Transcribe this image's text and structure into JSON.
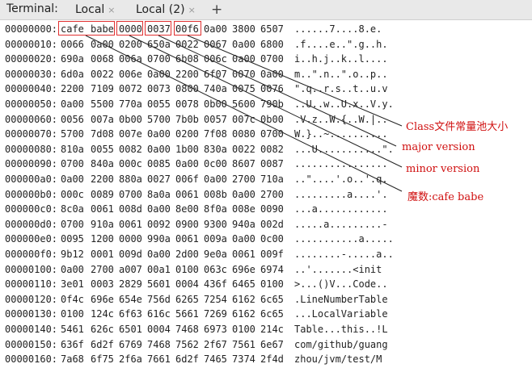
{
  "tabbar": {
    "title": "Terminal:",
    "tabs": [
      {
        "label": "Local",
        "close": "×"
      },
      {
        "label": "Local (2)",
        "close": "×"
      }
    ],
    "new_tab": "+"
  },
  "rows": [
    {
      "addr": "00000000:",
      "words": [
        "cafe",
        "babe",
        "0000",
        "0037",
        "00f6",
        "0a00",
        "3800",
        "6507"
      ],
      "ascii": "......7....8.e."
    },
    {
      "addr": "00000010:",
      "words": [
        "0066",
        "0a00",
        "0200",
        "650a",
        "0022",
        "0067",
        "0a00",
        "6800"
      ],
      "ascii": ".f....e..\".g..h."
    },
    {
      "addr": "00000020:",
      "words": [
        "690a",
        "0068",
        "006a",
        "0700",
        "6b08",
        "006c",
        "0a00",
        "0700"
      ],
      "ascii": "i..h.j..k..l...."
    },
    {
      "addr": "00000030:",
      "words": [
        "6d0a",
        "0022",
        "006e",
        "0a00",
        "2200",
        "6f07",
        "0070",
        "0a00"
      ],
      "ascii": "m..\".n..\".o..p.."
    },
    {
      "addr": "00000040:",
      "words": [
        "2200",
        "7109",
        "0072",
        "0073",
        "0800",
        "740a",
        "0075",
        "0076"
      ],
      "ascii": "\".q..r.s..t..u.v"
    },
    {
      "addr": "00000050:",
      "words": [
        "0a00",
        "5500",
        "770a",
        "0055",
        "0078",
        "0b00",
        "5600",
        "790b"
      ],
      "ascii": "..U..w..U.x..V.y."
    },
    {
      "addr": "00000060:",
      "words": [
        "0056",
        "007a",
        "0b00",
        "5700",
        "7b0b",
        "0057",
        "007c",
        "0b00"
      ],
      "ascii": ".V.z..W.{..W.|.."
    },
    {
      "addr": "00000070:",
      "words": [
        "5700",
        "7d08",
        "007e",
        "0a00",
        "0200",
        "7f08",
        "0080",
        "0700"
      ],
      "ascii": "W.}..~.........."
    },
    {
      "addr": "00000080:",
      "words": [
        "810a",
        "0055",
        "0082",
        "0a00",
        "1b00",
        "830a",
        "0022",
        "0082"
      ],
      "ascii": "...U...........\"."
    },
    {
      "addr": "00000090:",
      "words": [
        "0700",
        "840a",
        "000c",
        "0085",
        "0a00",
        "0c00",
        "8607",
        "0087"
      ],
      "ascii": "................"
    },
    {
      "addr": "000000a0:",
      "words": [
        "0a00",
        "2200",
        "880a",
        "0027",
        "006f",
        "0a00",
        "2700",
        "710a"
      ],
      "ascii": "..\"....'.o..'.q."
    },
    {
      "addr": "000000b0:",
      "words": [
        "000c",
        "0089",
        "0700",
        "8a0a",
        "0061",
        "008b",
        "0a00",
        "2700"
      ],
      "ascii": ".........a....'."
    },
    {
      "addr": "000000c0:",
      "words": [
        "8c0a",
        "0061",
        "008d",
        "0a00",
        "8e00",
        "8f0a",
        "008e",
        "0090"
      ],
      "ascii": "...a............"
    },
    {
      "addr": "000000d0:",
      "words": [
        "0700",
        "910a",
        "0061",
        "0092",
        "0900",
        "9300",
        "940a",
        "002d"
      ],
      "ascii": ".....a.........-"
    },
    {
      "addr": "000000e0:",
      "words": [
        "0095",
        "1200",
        "0000",
        "990a",
        "0061",
        "009a",
        "0a00",
        "0c00"
      ],
      "ascii": "...........a....."
    },
    {
      "addr": "000000f0:",
      "words": [
        "9b12",
        "0001",
        "009d",
        "0a00",
        "2d00",
        "9e0a",
        "0061",
        "009f"
      ],
      "ascii": "........-.....a.."
    },
    {
      "addr": "00000100:",
      "words": [
        "0a00",
        "2700",
        "a007",
        "00a1",
        "0100",
        "063c",
        "696e",
        "6974"
      ],
      "ascii": "..'.......<init"
    },
    {
      "addr": "00000110:",
      "words": [
        "3e01",
        "0003",
        "2829",
        "5601",
        "0004",
        "436f",
        "6465",
        "0100"
      ],
      "ascii": ">...()V...Code.."
    },
    {
      "addr": "00000120:",
      "words": [
        "0f4c",
        "696e",
        "654e",
        "756d",
        "6265",
        "7254",
        "6162",
        "6c65"
      ],
      "ascii": ".LineNumberTable"
    },
    {
      "addr": "00000130:",
      "words": [
        "0100",
        "124c",
        "6f63",
        "616c",
        "5661",
        "7269",
        "6162",
        "6c65"
      ],
      "ascii": "...LocalVariable"
    },
    {
      "addr": "00000140:",
      "words": [
        "5461",
        "626c",
        "6501",
        "0004",
        "7468",
        "6973",
        "0100",
        "214c"
      ],
      "ascii": "Table...this..!L"
    },
    {
      "addr": "00000150:",
      "words": [
        "636f",
        "6d2f",
        "6769",
        "7468",
        "7562",
        "2f67",
        "7561",
        "6e67"
      ],
      "ascii": "com/github/guang"
    },
    {
      "addr": "00000160:",
      "words": [
        "7a68",
        "6f75",
        "2f6a",
        "7661",
        "6d2f",
        "7465",
        "7374",
        "2f4d"
      ],
      "ascii": "zhou/jvm/test/M"
    }
  ],
  "annotations": [
    {
      "text": "Class文件常量池大小"
    },
    {
      "text": "major  version"
    },
    {
      "text": "minor  version"
    },
    {
      "text": "魔数:cafe  babe"
    }
  ],
  "colors": {
    "annotation": "#d01010",
    "box": "#e03030",
    "tabbar": "#e9e9e9"
  }
}
